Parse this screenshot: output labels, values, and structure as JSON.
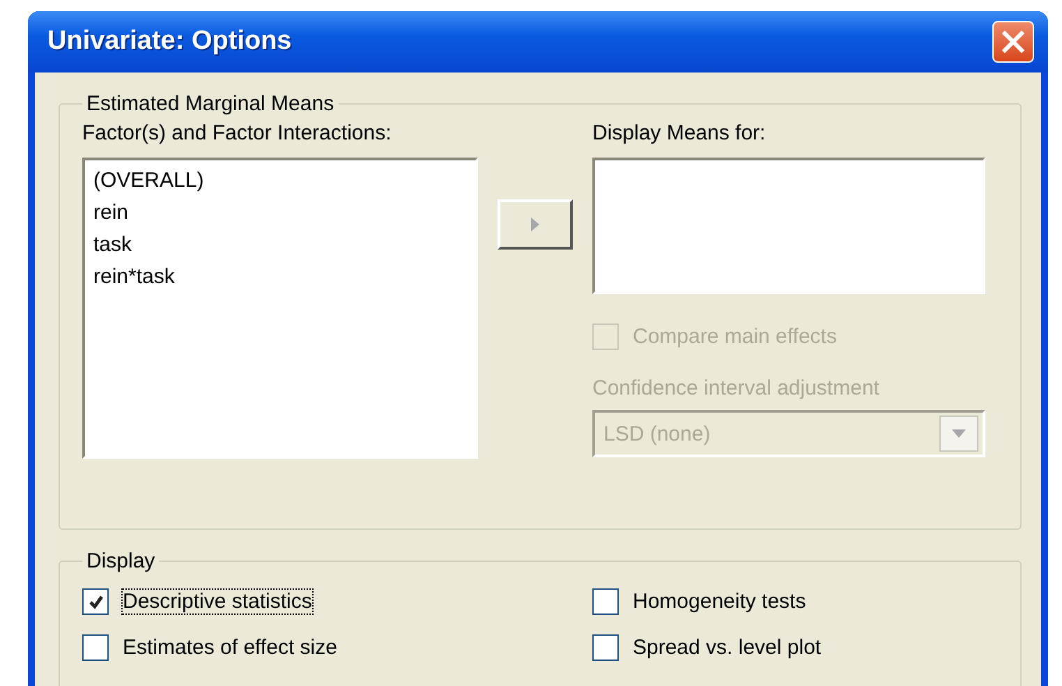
{
  "window": {
    "title": "Univariate: Options"
  },
  "estimated_marginal_means": {
    "title": "Estimated Marginal Means",
    "factors_label": "Factor(s) and Factor Interactions:",
    "factors": [
      {
        "label": "(OVERALL)",
        "selected": false
      },
      {
        "label": "rein",
        "selected": false
      },
      {
        "label": "task",
        "selected": false
      },
      {
        "label": "rein*task",
        "selected": false
      }
    ],
    "move_button": {
      "disabled": true
    },
    "display_means_label": "Display Means for:",
    "compare_main_effects": {
      "label": "Compare main effects",
      "checked": false,
      "disabled": true
    },
    "ci_adjustment": {
      "label": "Confidence interval adjustment",
      "value": "LSD (none)",
      "disabled": true
    }
  },
  "display": {
    "title": "Display",
    "options": [
      {
        "label": "Descriptive statistics",
        "checked": true,
        "focused": true
      },
      {
        "label": "Homogeneity tests",
        "checked": false,
        "focused": false
      },
      {
        "label": "Estimates of effect size",
        "checked": false,
        "focused": false
      },
      {
        "label": "Spread vs. level plot",
        "checked": false,
        "focused": false
      }
    ]
  }
}
